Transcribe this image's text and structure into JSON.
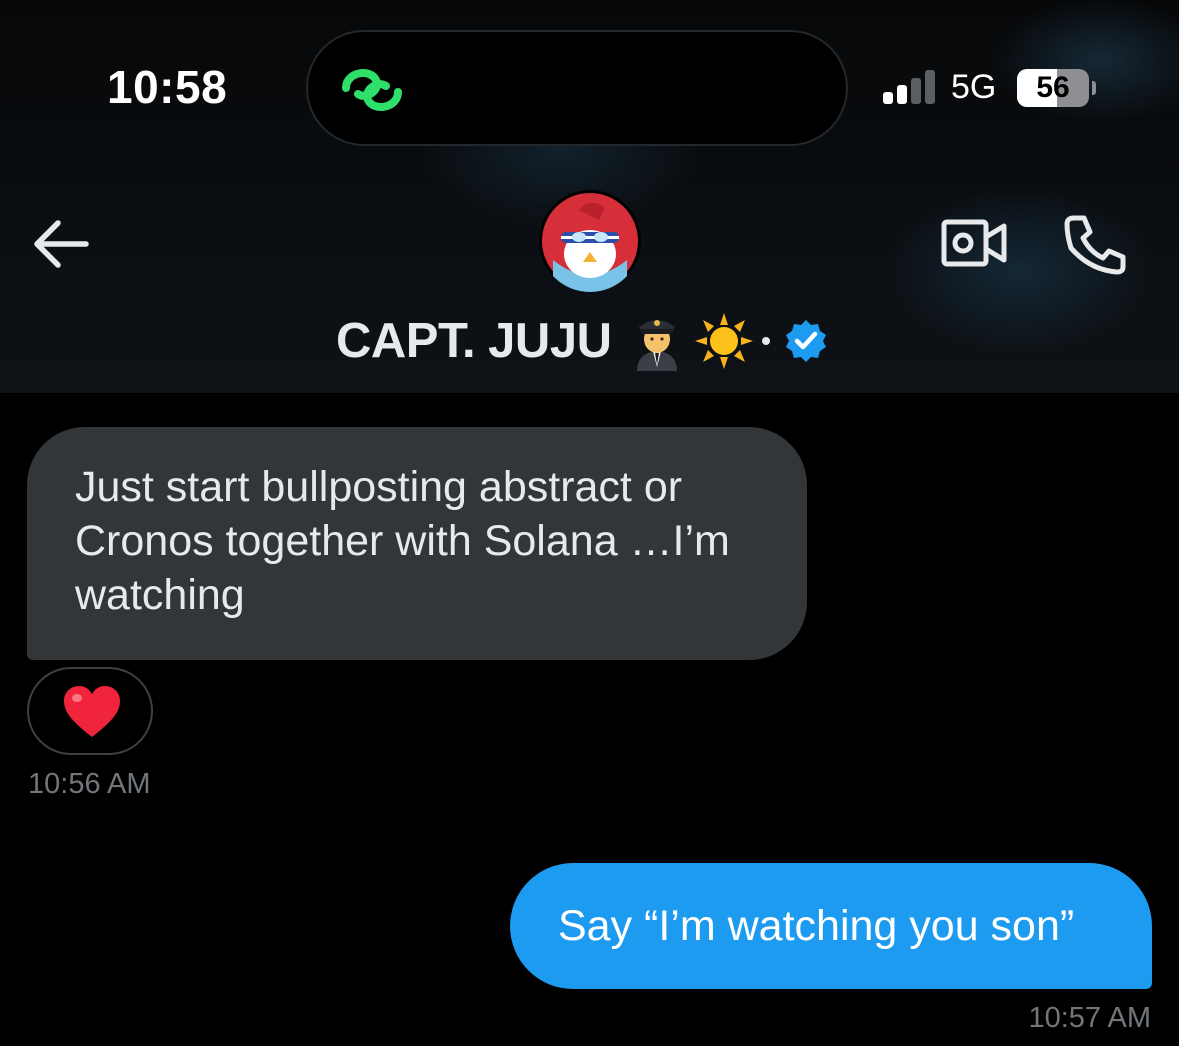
{
  "status_bar": {
    "time": "10:58",
    "network": "5G",
    "battery_level": "56",
    "battery_fraction": 0.56,
    "signal_bars_active": 2,
    "signal_bars_total": 4,
    "live_activity_icon": "green-link-icon"
  },
  "header": {
    "back_icon": "back-arrow-icon",
    "contact_name": "CAPT. JUJU",
    "name_emoji": "pilot-emoji sun-emoji",
    "verified_icon": "verified-badge-icon",
    "video_icon": "video-camera-icon",
    "call_icon": "phone-icon"
  },
  "messages": [
    {
      "direction": "incoming",
      "text": "Just start bullposting abstract or Cronos together with Solana …I’m watching",
      "reaction": "heart-emoji",
      "time": "10:56 AM"
    },
    {
      "direction": "outgoing",
      "text": "Say “I’m watching you son”",
      "time": "10:57 AM"
    }
  ],
  "colors": {
    "background": "#000000",
    "incoming_bubble": "#333639",
    "outgoing_bubble": "#1d9bf0",
    "timestamp": "#71767b",
    "accent_green": "#2ee06a",
    "verified_blue": "#1d9bf0"
  }
}
